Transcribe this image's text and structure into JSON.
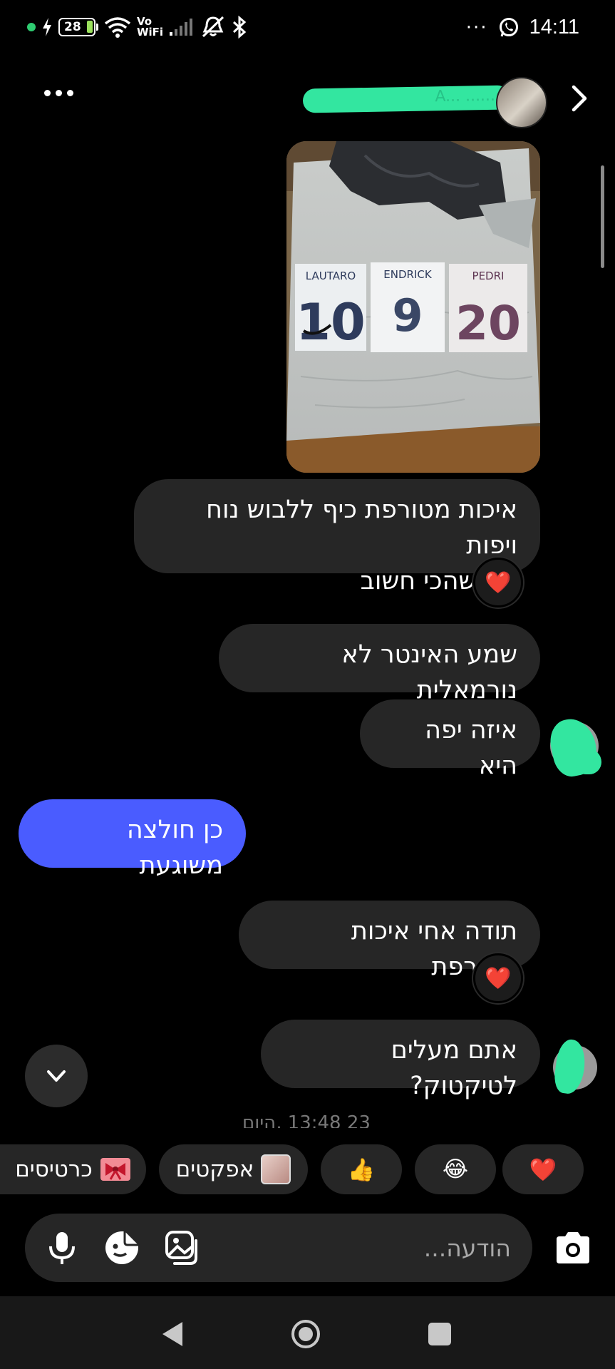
{
  "status_bar": {
    "battery_level": "28",
    "vowifi": [
      "Vo",
      "WiFi"
    ],
    "time": "14:11",
    "overflow": "···"
  },
  "header": {
    "title": "A... ......"
  },
  "messages": [
    {
      "id": "m1",
      "text_lines": [
        "איכות מטורפת כיף ללבוש נוח ויפות",
        "מה שהכי חשוב"
      ],
      "reaction": "❤️"
    },
    {
      "id": "m2",
      "text": "שמע האינטר לא נורמאלית"
    },
    {
      "id": "m3",
      "text": "איזה יפה היא"
    },
    {
      "id": "m4",
      "text": "כן חולצה משוגעת",
      "sent": true
    },
    {
      "id": "m5",
      "text": "תודה אחי איכות מטורפת",
      "reaction": "❤️"
    },
    {
      "id": "m6",
      "text": "אתם מעלים לטיקטוק?"
    }
  ],
  "photo": {
    "jerseys": [
      {
        "name": "LAUTARO",
        "number": "10"
      },
      {
        "name": "ENDRICK",
        "number": "9"
      },
      {
        "name": "PEDRI",
        "number": "20"
      }
    ]
  },
  "timestamp": "23 13:48 ,היום",
  "quick_replies": [
    {
      "id": "heart",
      "emoji": "❤️"
    },
    {
      "id": "laugh",
      "emoji": "😂"
    },
    {
      "id": "thumbs",
      "emoji": "👍"
    },
    {
      "id": "effects",
      "label": "אפקטים",
      "icon": "girl-face-sticker-icon"
    },
    {
      "id": "cards",
      "label": "כרטיסים",
      "icon": "bow-card-icon"
    }
  ],
  "composer": {
    "placeholder": "הודעה..."
  },
  "colors": {
    "background": "#000000",
    "bubble": "#262626",
    "sent_bubble": "#4a5cff",
    "redaction": "#33e6a0"
  }
}
